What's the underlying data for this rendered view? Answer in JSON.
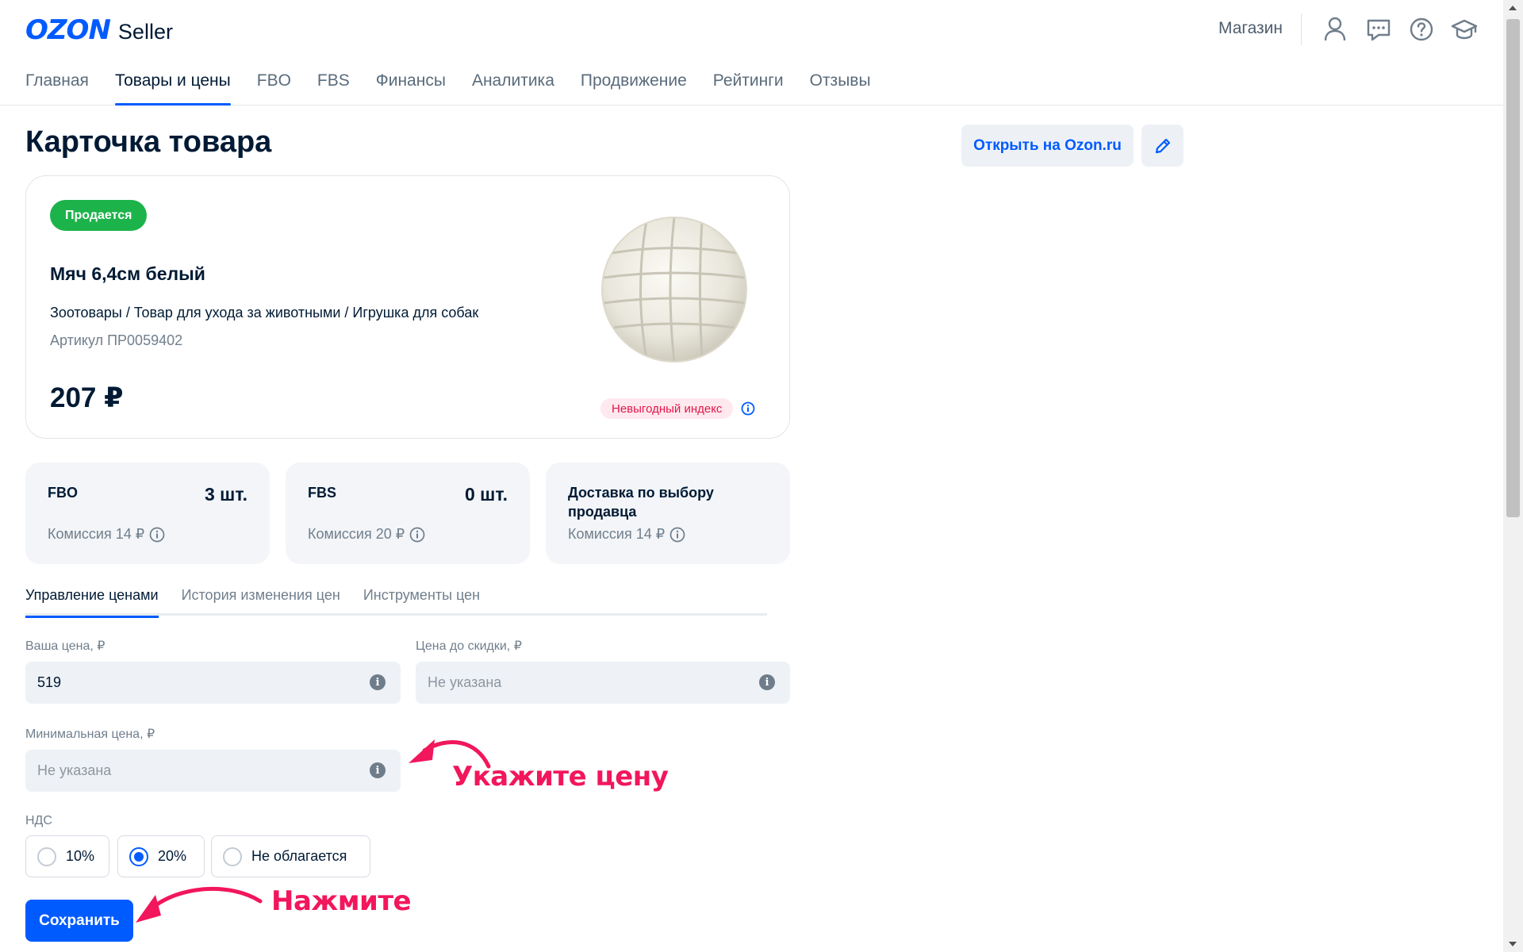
{
  "header": {
    "logo_brand": "OZON",
    "logo_product": "Seller",
    "shop_label": "Магазин",
    "icons": [
      "user-icon",
      "chat-icon",
      "help-icon",
      "education-icon"
    ]
  },
  "nav": {
    "items": [
      {
        "label": "Главная",
        "active": false
      },
      {
        "label": "Товары и цены",
        "active": true
      },
      {
        "label": "FBO",
        "active": false
      },
      {
        "label": "FBS",
        "active": false
      },
      {
        "label": "Финансы",
        "active": false
      },
      {
        "label": "Аналитика",
        "active": false
      },
      {
        "label": "Продвижение",
        "active": false
      },
      {
        "label": "Рейтинги",
        "active": false
      },
      {
        "label": "Отзывы",
        "active": false
      }
    ]
  },
  "page": {
    "title": "Карточка товара",
    "open_button": "Открыть на Ozon.ru"
  },
  "product": {
    "status": "Продается",
    "name": "Мяч 6,4см белый",
    "category": "Зоотовары / Товар для ухода за животными / Игрушка для собак",
    "sku": "Артикул ПР0059402",
    "price": "207 ₽",
    "index_badge": "Невыгодный индекс"
  },
  "stocks": [
    {
      "title": "FBO",
      "qty": "3 шт.",
      "fee": "Комиссия 14 ₽"
    },
    {
      "title": "FBS",
      "qty": "0 шт.",
      "fee": "Комиссия 20 ₽"
    },
    {
      "title": "Доставка по выбору продавца",
      "qty": "",
      "fee": "Комиссия 14 ₽"
    }
  ],
  "tabs": [
    {
      "label": "Управление ценами",
      "active": true
    },
    {
      "label": "История изменения цен",
      "active": false
    },
    {
      "label": "Инструменты цен",
      "active": false
    }
  ],
  "form": {
    "your_price_label": "Ваша цена, ₽",
    "your_price_value": "519",
    "old_price_label": "Цена до скидки, ₽",
    "old_price_placeholder": "Не указана",
    "min_price_label": "Минимальная цена, ₽",
    "min_price_placeholder": "Не указана",
    "vat_label": "НДС",
    "vat_options": [
      {
        "label": "10%",
        "checked": false
      },
      {
        "label": "20%",
        "checked": true
      },
      {
        "label": "Не облагается",
        "checked": false
      }
    ],
    "save_button": "Сохранить"
  },
  "annotations": {
    "price_hint": "Укажите цену",
    "click_hint": "Нажмите"
  },
  "colors": {
    "accent": "#005bff",
    "status_green": "#1db34b",
    "annotation_pink": "#f2165c",
    "warning_red": "#e0174b"
  }
}
